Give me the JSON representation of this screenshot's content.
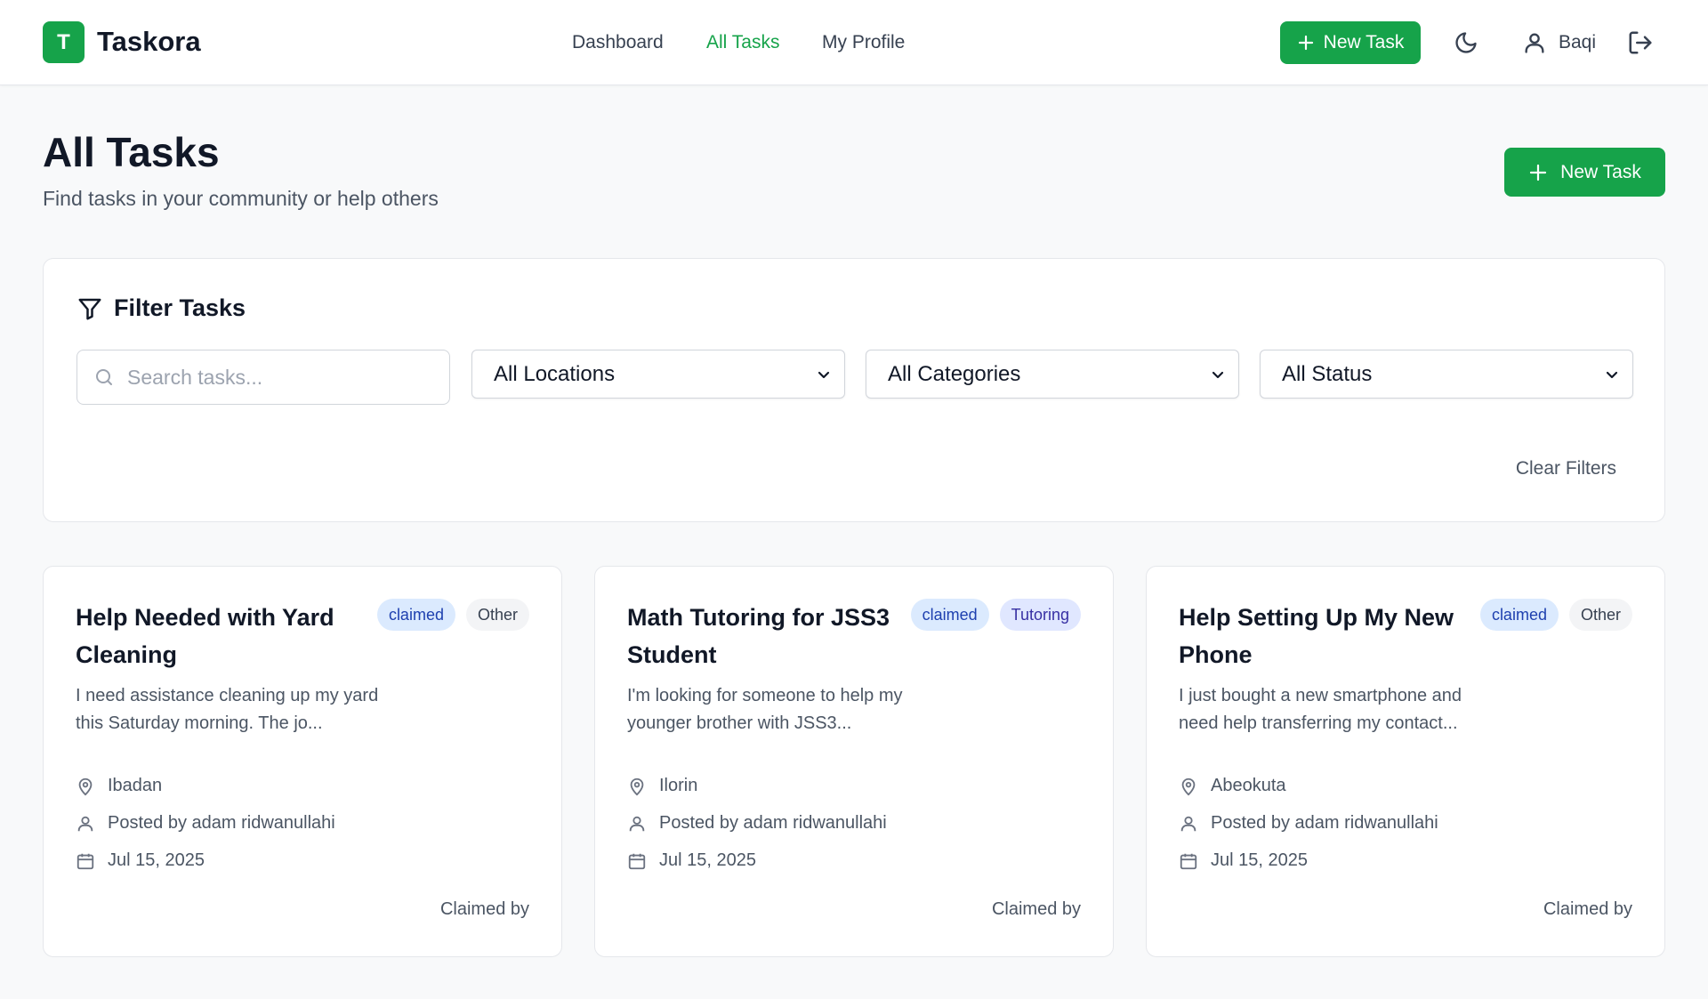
{
  "header": {
    "logo_letter": "T",
    "brand": "Taskora",
    "nav": [
      {
        "label": "Dashboard"
      },
      {
        "label": "All Tasks"
      },
      {
        "label": "My Profile"
      }
    ],
    "new_task_label": "New Task",
    "user_name": "Baqi"
  },
  "page": {
    "title": "All Tasks",
    "subtitle": "Find tasks in your community or help others",
    "new_task_label": "New Task"
  },
  "filters": {
    "title": "Filter Tasks",
    "search_placeholder": "Search tasks...",
    "location": "All Locations",
    "category": "All Categories",
    "status": "All Status",
    "clear_label": "Clear Filters"
  },
  "tasks": [
    {
      "title": "Help Needed with Yard Cleaning",
      "status": "claimed",
      "category": "Other",
      "description": "I need assistance cleaning up my yard this Saturday morning. The jo...",
      "location": "Ibadan",
      "posted_by": "Posted by adam ridwanullahi",
      "date": "Jul 15, 2025",
      "claimed_label": "Claimed by"
    },
    {
      "title": "Math Tutoring for JSS3 Student",
      "status": "claimed",
      "category": "Tutoring",
      "description": "I'm looking for someone to help my younger brother with JSS3...",
      "location": "Ilorin",
      "posted_by": "Posted by adam ridwanullahi",
      "date": "Jul 15, 2025",
      "claimed_label": "Claimed by"
    },
    {
      "title": "Help Setting Up My New Phone",
      "status": "claimed",
      "category": "Other",
      "description": "I just bought a new smartphone and need help transferring my contact...",
      "location": "Abeokuta",
      "posted_by": "Posted by adam ridwanullahi",
      "date": "Jul 15, 2025",
      "claimed_label": "Claimed by"
    }
  ],
  "colors": {
    "accent": "#16a34a",
    "status_badge_bg": "#dbeafe",
    "tutoring_badge_bg": "#e0e7ff"
  }
}
